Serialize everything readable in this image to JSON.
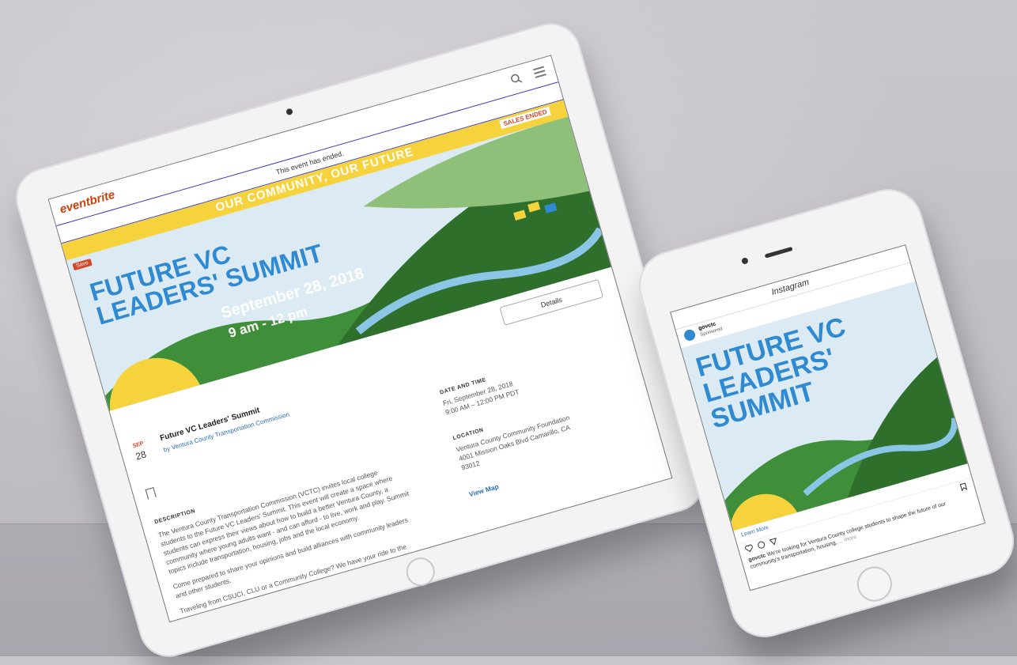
{
  "tablet": {
    "logo": "eventbrite",
    "notice": "This event has ended.",
    "hero": {
      "banner": "OUR COMMUNITY, OUR FUTURE",
      "sales_badge": "SALES ENDED",
      "save_badge": "Save",
      "title_line1": "FUTURE VC",
      "title_line2": "LEADERS' SUMMIT",
      "date": "September 28, 2018",
      "time": "9 am - 12 pm"
    },
    "details_button": "Details",
    "month": "SEP",
    "day": "28",
    "event_title": "Future VC Leaders' Summit",
    "organizer": "by Ventura County Transportation Commission",
    "description_heading": "DESCRIPTION",
    "description_p1": "The Ventura County Transportation Commission (VCTC) invites local college students to the Future VC Leaders' Summit. This event will create a space where students can express their views about how to build a better Ventura County, a community where young adults want - and can afford - to live, work and play. Summit topics include transportation, housing, jobs and the local economy.",
    "description_p2": "Come prepared to share your opinions and build alliances with community leaders and other students.",
    "description_p3": "Traveling from CSUCI, CLU or a Community College? We have your ride to the summit covered. VCTC will provide",
    "datetime_heading": "DATE AND TIME",
    "datetime_line1": "Fri, September 28, 2018",
    "datetime_line2": "9:00 AM – 12:00 PM PDT",
    "location_heading": "LOCATION",
    "location_lines": "Ventura County Community Foundation 4001 Mission Oaks Blvd Camarillo, CA 93012",
    "view_map": "View Map"
  },
  "phone": {
    "app_title": "Instagram",
    "username": "govctc",
    "sponsored": "Sponsored",
    "image_line1": "FUTURE VC",
    "image_line2": "LEADERS'",
    "image_line3": "SUMMIT",
    "learn_more": "Learn More",
    "caption_user": "govctc",
    "caption_text": "We're looking for Ventura County college students to shape the future of our community's transportation, housing,",
    "caption_more": "... more"
  },
  "colors": {
    "brand_blue": "#2f8ad2",
    "banner_yellow": "#f6d33c",
    "eventbrite_orange": "#d1410c",
    "hill_green": "#3f8f3a"
  }
}
